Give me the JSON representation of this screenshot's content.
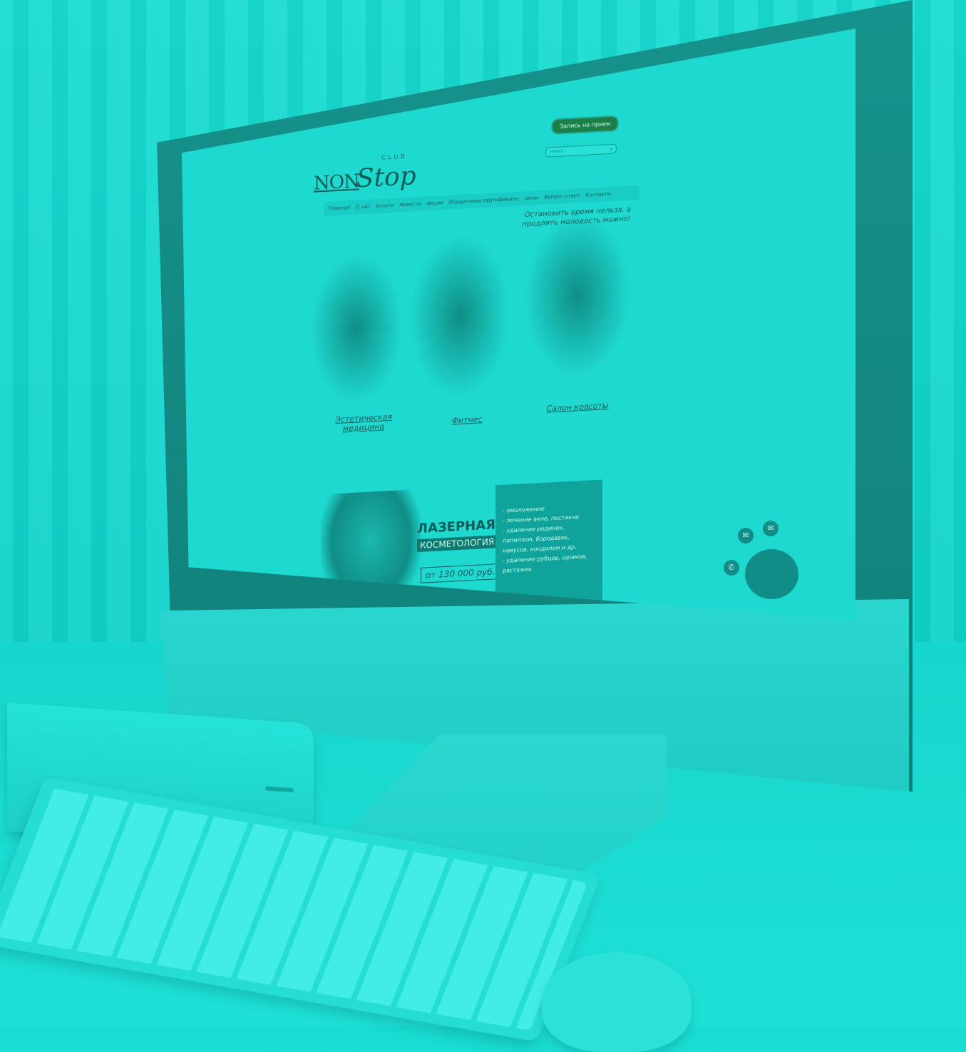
{
  "site": {
    "logo": {
      "non": "NON",
      "stop": "Stop",
      "club": "CLUB"
    },
    "cta": "Запись на прием",
    "search_placeholder": "поиск",
    "nav": [
      "Главная",
      "О нас",
      "Услуги",
      "Новости",
      "Акции",
      "Подарочные сертификаты",
      "Цены",
      "Вопрос-ответ",
      "Контакты"
    ],
    "tagline": "Остановить время нельзя, а продлить молодость можно!",
    "sections": [
      {
        "title": "Эстетическая медицина",
        "desc": ""
      },
      {
        "title": "Фитнес",
        "desc": ""
      },
      {
        "title": "Салон красоты",
        "desc": ""
      }
    ],
    "banner": {
      "title": "ЛАЗЕРНАЯ",
      "subtitle": "КОСМЕТОЛОГИЯ",
      "price": "от 130 000 руб.",
      "list": [
        "- омоложение",
        "- лечение акне, постакне",
        "- удаление родинок, папиллом, бородавок, невусов, кондилом и др.",
        "- удаление рубцов, шрамов, растяжек"
      ]
    }
  },
  "icons": {
    "search": "search-icon",
    "phone": "phone-icon",
    "chat": "chat-icon",
    "mail": "mail-icon"
  },
  "colors": {
    "tint": "#11d4cb",
    "dark": "#0e5b57",
    "accent": "#0fa39b"
  }
}
